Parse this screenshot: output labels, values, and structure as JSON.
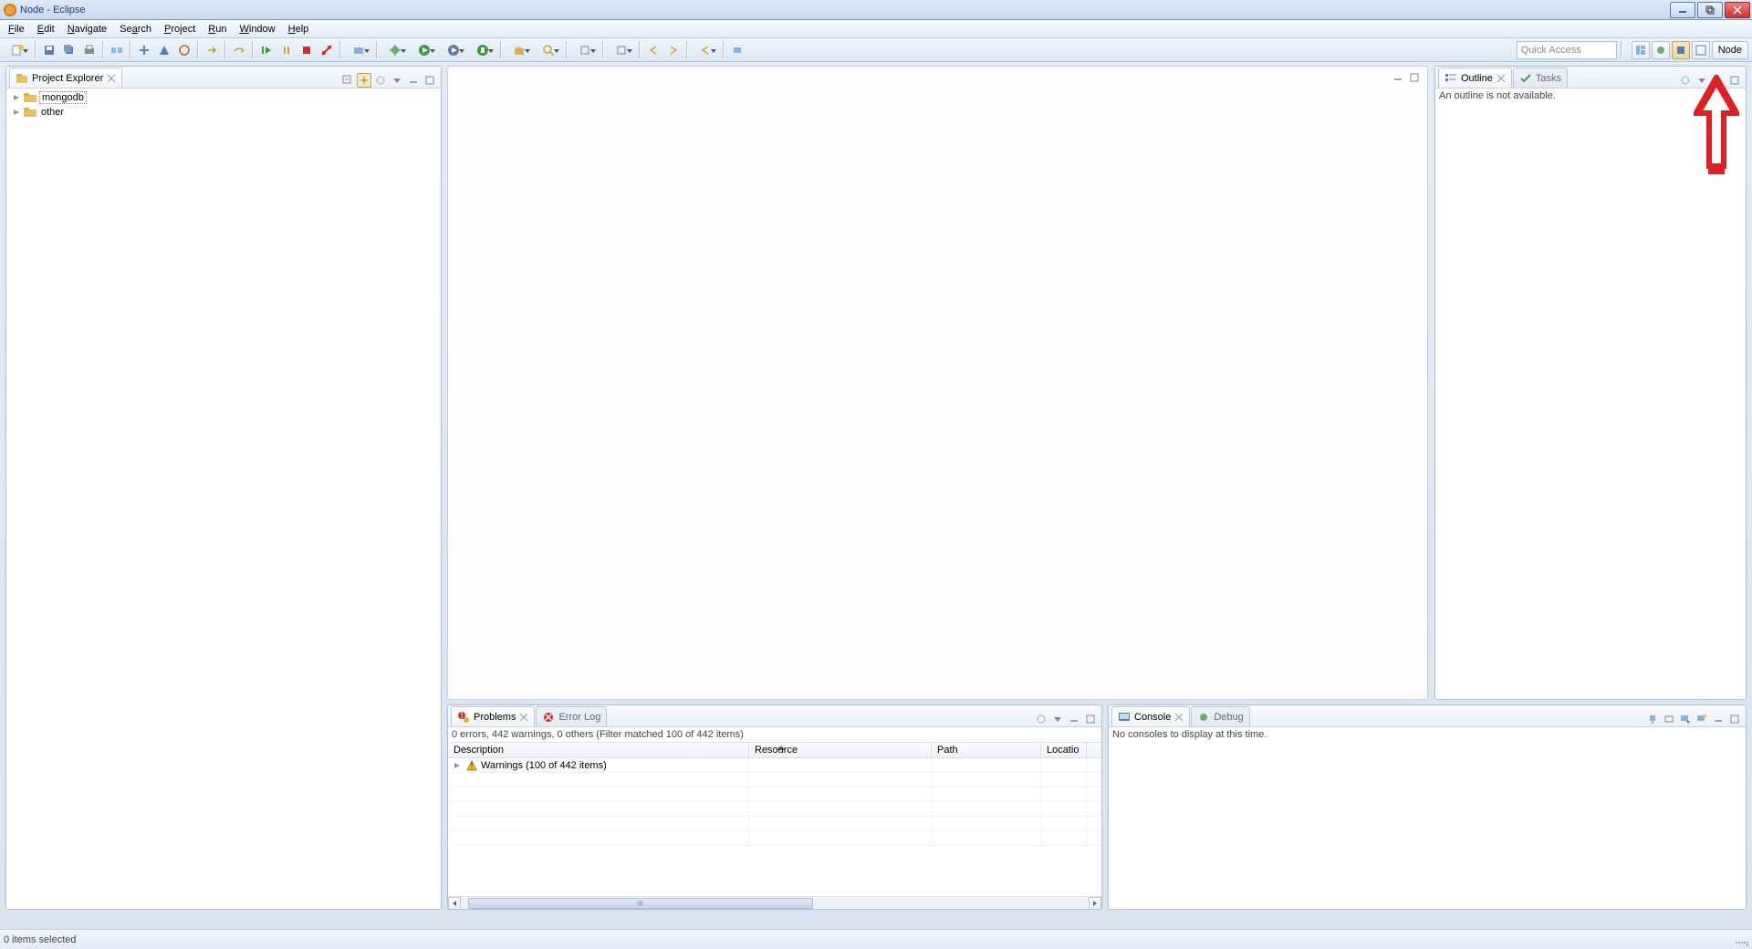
{
  "window": {
    "title": "Node - Eclipse"
  },
  "menubar": [
    "File",
    "Edit",
    "Navigate",
    "Search",
    "Project",
    "Run",
    "Window",
    "Help"
  ],
  "toolbar": {
    "quick_access_placeholder": "Quick Access",
    "perspective_label": "Node"
  },
  "project_explorer": {
    "tab_label": "Project Explorer",
    "items": [
      {
        "label": "mongodb",
        "selected": true
      },
      {
        "label": "other",
        "selected": false
      }
    ]
  },
  "outline": {
    "tab_label": "Outline",
    "tasks_tab_label": "Tasks",
    "message": "An outline is not available."
  },
  "problems": {
    "tab_label": "Problems",
    "errorlog_tab_label": "Error Log",
    "status_line": "0 errors, 442 warnings, 0 others (Filter matched 100 of 442 items)",
    "columns": [
      "Description",
      "Resource",
      "Path",
      "Locatio"
    ],
    "warning_row": "Warnings (100 of 442 items)"
  },
  "console": {
    "tab_label": "Console",
    "debug_tab_label": "Debug",
    "message": "No consoles to display at this time."
  },
  "statusbar": {
    "text": "0 items selected"
  }
}
